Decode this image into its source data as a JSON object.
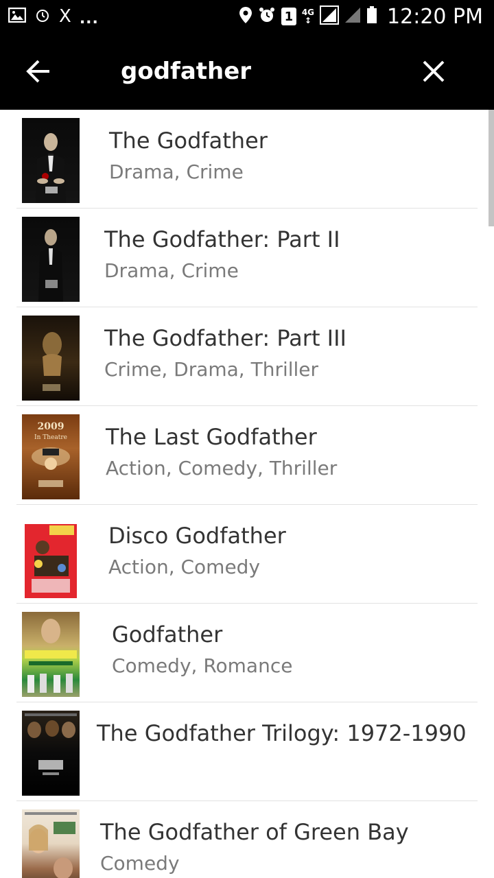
{
  "status_bar": {
    "left_icons": [
      "image-icon",
      "alarm-icon",
      "x-icon",
      "more-dots-icon"
    ],
    "x_text": "X",
    "dots_text": "...",
    "sim_badge": "1",
    "network": "4G",
    "time": "12:20 PM"
  },
  "app_bar": {
    "query": "godfather",
    "back_icon": "arrow-left-icon",
    "clear_icon": "close-icon"
  },
  "results": [
    {
      "title": "The Godfather",
      "genres": "Drama, Crime"
    },
    {
      "title": "The Godfather: Part II",
      "genres": "Drama, Crime"
    },
    {
      "title": "The Godfather: Part III",
      "genres": "Crime, Drama, Thriller"
    },
    {
      "title": "The Last Godfather",
      "genres": "Action, Comedy, Thriller"
    },
    {
      "title": "Disco Godfather",
      "genres": "Action, Comedy"
    },
    {
      "title": "Godfather",
      "genres": "Comedy, Romance"
    },
    {
      "title": "The Godfather Trilogy: 1972-1990",
      "genres": ""
    },
    {
      "title": "The Godfather of Green Bay",
      "genres": "Comedy"
    }
  ],
  "posters": {
    "last_godfather_banner": "2009",
    "last_godfather_sub": "In Theatre"
  },
  "colors": {
    "bar_bg": "#000000",
    "title_text": "#333333",
    "genre_text": "#7a7a7a",
    "divider": "#e2e2e2"
  }
}
